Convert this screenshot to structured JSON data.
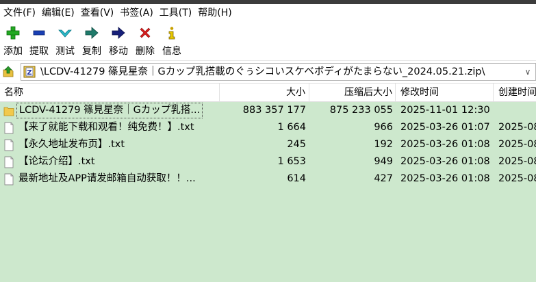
{
  "menu": [
    "文件(F)",
    "编辑(E)",
    "查看(V)",
    "书签(A)",
    "工具(T)",
    "帮助(H)"
  ],
  "toolbar": [
    {
      "label": "添加",
      "icon": "plus-icon"
    },
    {
      "label": "提取",
      "icon": "minus-icon"
    },
    {
      "label": "测试",
      "icon": "check-icon"
    },
    {
      "label": "复制",
      "icon": "copy-arrow-icon"
    },
    {
      "label": "移动",
      "icon": "move-arrow-icon"
    },
    {
      "label": "删除",
      "icon": "delete-x-icon"
    },
    {
      "label": "信息",
      "icon": "info-icon"
    }
  ],
  "address": {
    "path": "\\LCDV-41279 篠見星奈｜Gカップ乳搭載のぐぅシコいスケベボディがたまらない_2024.05.21.zip\\"
  },
  "columns": {
    "name": "名称",
    "size": "大小",
    "packed": "压缩后大小",
    "modified": "修改时间",
    "created": "创建时间"
  },
  "files": [
    {
      "type": "folder",
      "name": "LCDV-41279 篠見星奈｜Gカップ乳搭...",
      "size": "883 357 177",
      "packed": "875 233 055",
      "modified": "2025-11-01 12:30",
      "created": ""
    },
    {
      "type": "file",
      "name": "【来了就能下载和观看！纯免费！】.txt",
      "size": "1 664",
      "packed": "966",
      "modified": "2025-03-26 01:07",
      "created": "2025-08"
    },
    {
      "type": "file",
      "name": "【永久地址发布页】.txt",
      "size": "245",
      "packed": "192",
      "modified": "2025-03-26 01:08",
      "created": "2025-08"
    },
    {
      "type": "file",
      "name": "【论坛介绍】.txt",
      "size": "1 653",
      "packed": "949",
      "modified": "2025-03-26 01:08",
      "created": "2025-08"
    },
    {
      "type": "file",
      "name": "最新地址及APP请发邮箱自动获取！！...",
      "size": "614",
      "packed": "427",
      "modified": "2025-03-26 01:08",
      "created": "2025-08"
    }
  ],
  "colors": {
    "list_background": "#cde8cd",
    "plus": "#22a822",
    "minus": "#1a3fb4",
    "check": "#2bb8c8",
    "delete": "#d81e1e",
    "info": "#c8a000"
  }
}
